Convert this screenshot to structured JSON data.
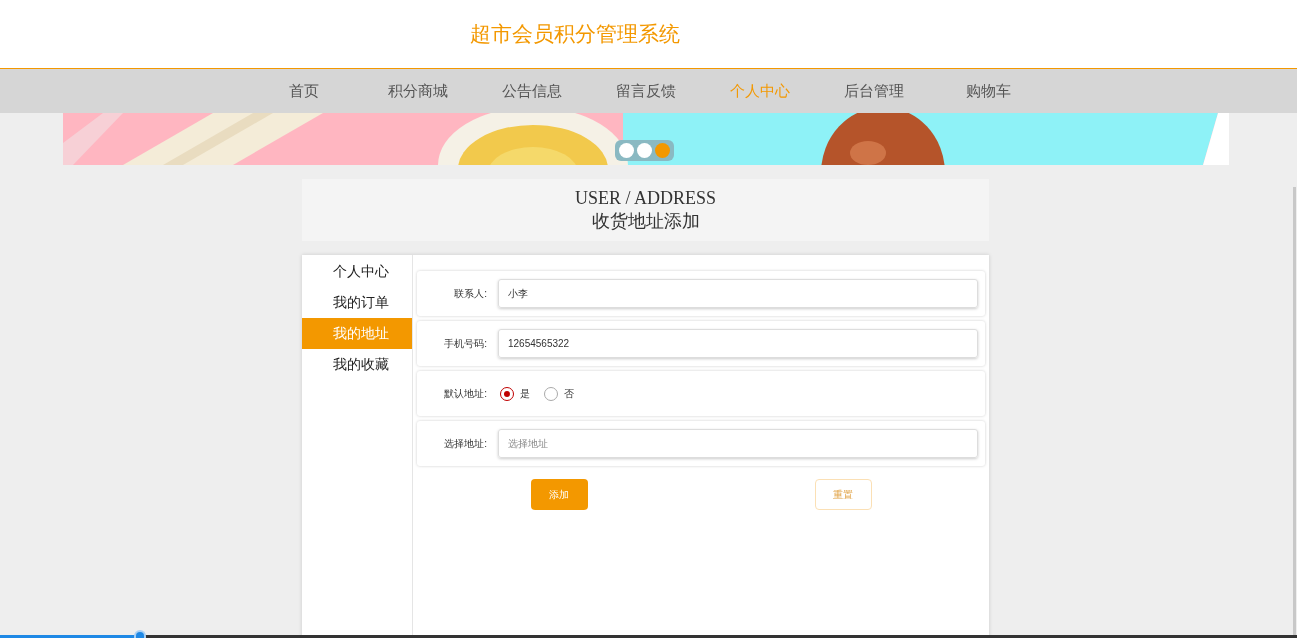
{
  "header": {
    "title": "超市会员积分管理系统"
  },
  "nav": [
    {
      "label": "首页",
      "selected": false
    },
    {
      "label": "积分商城",
      "selected": false
    },
    {
      "label": "公告信息",
      "selected": false
    },
    {
      "label": "留言反馈",
      "selected": false
    },
    {
      "label": "个人中心",
      "selected": true
    },
    {
      "label": "后台管理",
      "selected": false
    },
    {
      "label": "购物车",
      "selected": false
    }
  ],
  "banner": {
    "kind": "picture",
    "dots": [
      {
        "selected": false
      },
      {
        "selected": false
      },
      {
        "selected": true
      }
    ]
  },
  "page_heading": {
    "subtitle": "USER / ADDRESS",
    "title": "收货地址添加"
  },
  "sidebar": [
    {
      "label": "个人中心",
      "selected": false
    },
    {
      "label": "我的订单",
      "selected": false
    },
    {
      "label": "我的地址",
      "selected": true
    },
    {
      "label": "我的收藏",
      "selected": false
    }
  ],
  "form": {
    "fields": [
      {
        "kind": "text",
        "label": "联系人:",
        "value": "小李"
      },
      {
        "kind": "text",
        "label": "手机号码:",
        "value": "12654565322"
      },
      {
        "kind": "radio",
        "label": "默认地址:",
        "options": [
          {
            "label": "是",
            "selected": true
          },
          {
            "label": "否",
            "selected": false
          }
        ]
      },
      {
        "kind": "text",
        "label": "选择地址:",
        "placeholder": "选择地址"
      }
    ],
    "buttons": [
      {
        "kind": "primary",
        "label": "添加"
      },
      {
        "kind": "outline",
        "label": "重置"
      }
    ]
  },
  "playback_bar": {
    "level": 0.108
  }
}
